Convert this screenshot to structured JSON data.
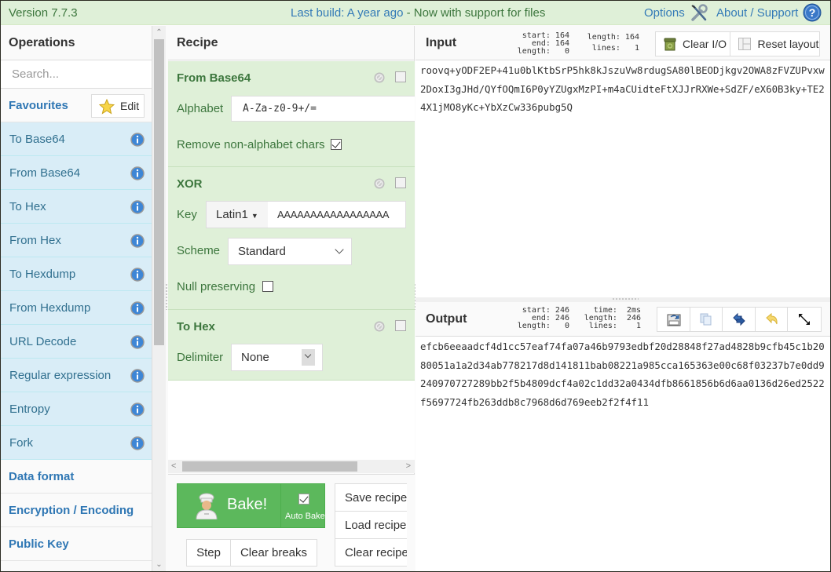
{
  "banner": {
    "version": "Version 7.7.3",
    "notice_link": "Last build: A year ago",
    "notice_rest": " - Now with support for files",
    "options": "Options",
    "about": "About / Support",
    "wrench_icon": "wrench-screwdriver-icon",
    "help_icon": "help-circle-icon"
  },
  "operations": {
    "title": "Operations",
    "search_placeholder": "Search...",
    "favourites_label": "Favourites",
    "edit_label": "Edit",
    "items": [
      {
        "label": "To Base64"
      },
      {
        "label": "From Base64"
      },
      {
        "label": "To Hex"
      },
      {
        "label": "From Hex"
      },
      {
        "label": "To Hexdump"
      },
      {
        "label": "From Hexdump"
      },
      {
        "label": "URL Decode"
      },
      {
        "label": "Regular expression"
      },
      {
        "label": "Entropy"
      },
      {
        "label": "Fork"
      }
    ],
    "categories": [
      {
        "label": "Data format"
      },
      {
        "label": "Encryption / Encoding"
      },
      {
        "label": "Public Key"
      }
    ]
  },
  "recipe": {
    "title": "Recipe",
    "ops": [
      {
        "name": "From Base64",
        "alphabet_label": "Alphabet",
        "alphabet_value": "A-Za-z0-9+/=",
        "remove_label": "Remove non-alphabet chars",
        "remove_checked": true
      },
      {
        "name": "XOR",
        "key_label": "Key",
        "key_encoding": "Latin1",
        "key_value": "AAAAAAAAAAAAAAAAA",
        "scheme_label": "Scheme",
        "scheme_value": "Standard",
        "null_label": "Null preserving",
        "null_checked": false
      },
      {
        "name": "To Hex",
        "delimiter_label": "Delimiter",
        "delimiter_value": "None"
      }
    ],
    "bake_label": "Bake!",
    "auto_bake_label": "Auto Bake",
    "auto_bake_checked": true,
    "step_label": "Step",
    "clear_breaks_label": "Clear breaks",
    "save_label": "Save recipe",
    "load_label": "Load recipe",
    "clear_label": "Clear recipe"
  },
  "input": {
    "title": "Input",
    "stats_left": "start: 164\n  end: 164\nlength:   0",
    "stats_right": "length: 164\n lines:   1",
    "clear_io_label": "Clear I/O",
    "reset_layout_label": "Reset layout",
    "text": "roovq+yODF2EP+41u0blKtbSrP5hk8kJszuVw8rdugSA80lBEODjkgv2OWA8zFVZUPvxw2DoxI3gJHd/QYfOQmI6P0yYZUgxMzPI+m4aCUidteFtXJJrRXWe+SdZF/eX60B3ky+TE24X1jMO8yKc+YbXzCw336pubg5Q"
  },
  "output": {
    "title": "Output",
    "stats_left": "start: 246\n  end: 246\nlength:   0",
    "stats_right": "  time:  2ms\nlength:  246\n lines:    1",
    "buttons": [
      "save-to-file-icon",
      "copy-icon",
      "swap-io-icon",
      "undo-icon",
      "maximise-icon"
    ],
    "text": "efcb6eeaadcf4d1cc57eaf74fa07a46b9793edbf20d28848f27ad4828b9cfb45c1b2080051a1a2d34ab778217d8d141811bab08221a985cca165363e00c68f03237b7e0dd9240970727289bb2f5b4809dcf4a02c1dd32a0434dfb8661856b6d6aa0136d26ed2522f5697724fb263ddb8c7968d6d769eeb2f2f4f11"
  },
  "colors": {
    "banner_bg": "#dff0d8",
    "op_bg": "#d9edf7",
    "recipe_op_bg": "#dff0d8",
    "bake_green": "#5cb85c",
    "link_blue": "#337ab7"
  }
}
